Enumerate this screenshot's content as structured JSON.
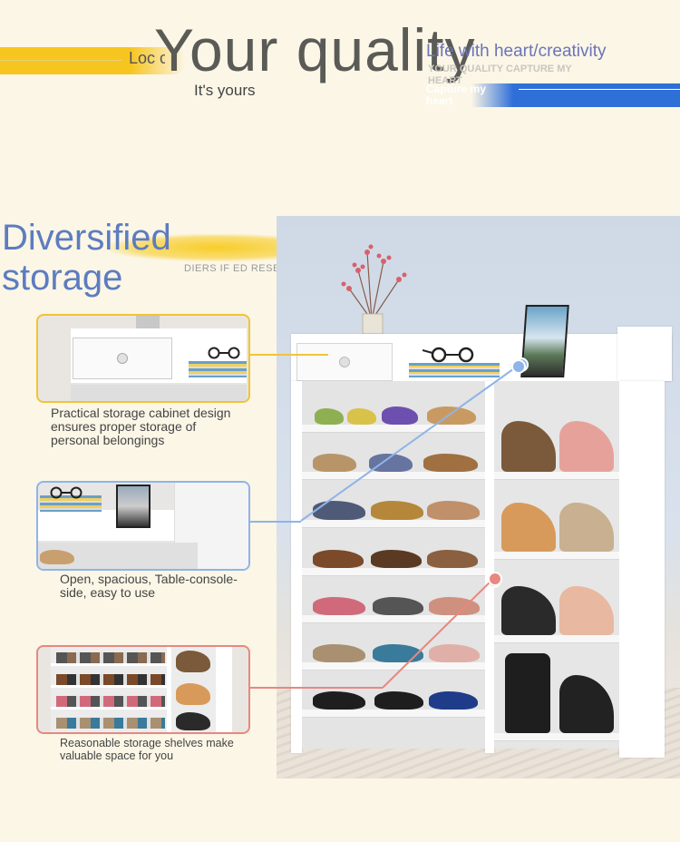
{
  "header": {
    "loc_text": "Loc clo",
    "main_title": "Your quality",
    "sub_title": "It's yours",
    "tagline": "Life with heart/creativity",
    "small_caps": "YOUR QUALITY CAPTURE MY HEART",
    "small_caps_2": "Capture my heart"
  },
  "section": {
    "title_line1": "Diversified",
    "title_line2": "storage",
    "subtitle": "DIERS IF ED RESERV OR"
  },
  "details": [
    {
      "caption": "Practical storage cabinet design ensures proper storage of personal belongings",
      "color": "#f0c437"
    },
    {
      "caption": "Open, spacious, Table-console-side, easy to use",
      "color": "#8fb4e8"
    },
    {
      "caption": "Reasonable storage shelves make valuable space for you",
      "color": "#e88880"
    }
  ],
  "colors": {
    "background": "#fbf6e6",
    "accent_yellow": "#f7c520",
    "accent_blue": "#2f6fd8",
    "title_blue": "#5d7cc0"
  }
}
